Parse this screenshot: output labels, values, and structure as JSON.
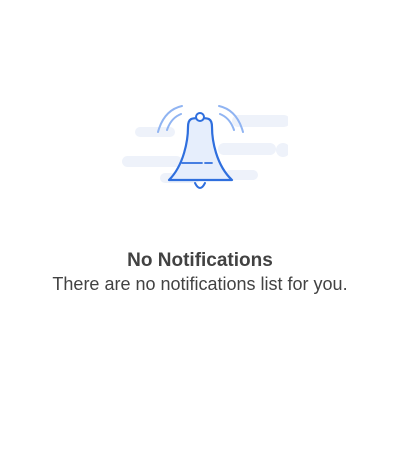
{
  "empty_state": {
    "icon": "bell-ringing-icon",
    "title": "No Notifications",
    "message": "There are no notifications list for you."
  },
  "colors": {
    "accent": "#2f6fde",
    "wave_light": "#90b4f2",
    "cloud": "#eef2fa",
    "bell_fill": "#e6eefc",
    "text": "#424242",
    "background": "#ffffff"
  }
}
